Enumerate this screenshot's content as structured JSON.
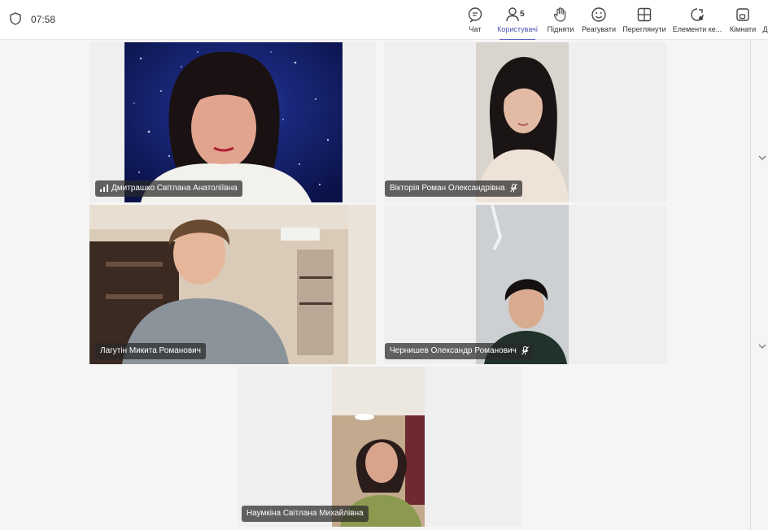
{
  "status": {
    "time": "07:58"
  },
  "toolbar": {
    "items": [
      {
        "label": "Чат",
        "icon": "chat-icon"
      },
      {
        "label": "Користувачі",
        "icon": "people-icon",
        "count": "5",
        "active": true
      },
      {
        "label": "Підняти",
        "icon": "raise-hand-icon"
      },
      {
        "label": "Реагувати",
        "icon": "react-icon"
      },
      {
        "label": "Переглянути",
        "icon": "view-icon"
      },
      {
        "label": "Елементи ке...",
        "icon": "apps-icon"
      },
      {
        "label": "Кімнати",
        "icon": "rooms-icon"
      },
      {
        "label": "Д",
        "icon": "more-icon"
      }
    ]
  },
  "participants": [
    {
      "name": "Дмитрашко Світлана Анатоліївна",
      "icon": "signal-bars-icon"
    },
    {
      "name": "Вікторія Роман Олександрівна",
      "icon": "mic-muted-icon"
    },
    {
      "name": "Лагутін Микита Романович"
    },
    {
      "name": "Чернишев Олександр Романович",
      "icon": "mic-muted-icon"
    },
    {
      "name": "Наумкіна Світлана Михайлівна"
    }
  ],
  "colors": {
    "accent": "#5b5fc7",
    "chip_bg": "#282828"
  }
}
